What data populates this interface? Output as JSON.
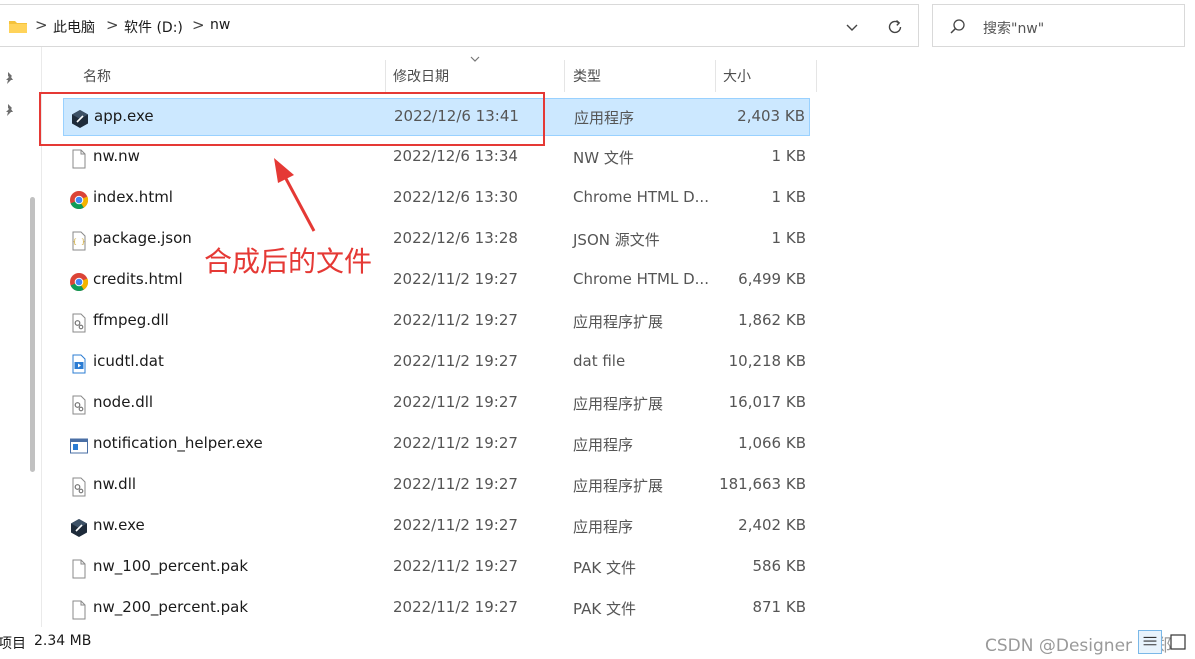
{
  "breadcrumb": {
    "items": [
      "此电脑",
      "软件 (D:)",
      "nw"
    ],
    "separator": ">"
  },
  "search": {
    "placeholder": "搜索\"nw\""
  },
  "columns": {
    "name": "名称",
    "date": "修改日期",
    "type": "类型",
    "size": "大小"
  },
  "files": [
    {
      "name": "app.exe",
      "date": "2022/12/6 13:41",
      "type": "应用程序",
      "size": "2,403 KB",
      "icon": "nw-exe-icon",
      "selected": true
    },
    {
      "name": "nw.nw",
      "date": "2022/12/6 13:34",
      "type": "NW 文件",
      "size": "1 KB",
      "icon": "file-icon"
    },
    {
      "name": "index.html",
      "date": "2022/12/6 13:30",
      "type": "Chrome HTML D...",
      "size": "1 KB",
      "icon": "chrome-icon"
    },
    {
      "name": "package.json",
      "date": "2022/12/6 13:28",
      "type": "JSON 源文件",
      "size": "1 KB",
      "icon": "json-file-icon"
    },
    {
      "name": "credits.html",
      "date": "2022/11/2 19:27",
      "type": "Chrome HTML D...",
      "size": "6,499 KB",
      "icon": "chrome-icon"
    },
    {
      "name": "ffmpeg.dll",
      "date": "2022/11/2 19:27",
      "type": "应用程序扩展",
      "size": "1,862 KB",
      "icon": "dll-icon"
    },
    {
      "name": "icudtl.dat",
      "date": "2022/11/2 19:27",
      "type": "dat file",
      "size": "10,218 KB",
      "icon": "media-file-icon"
    },
    {
      "name": "node.dll",
      "date": "2022/11/2 19:27",
      "type": "应用程序扩展",
      "size": "16,017 KB",
      "icon": "dll-icon"
    },
    {
      "name": "notification_helper.exe",
      "date": "2022/11/2 19:27",
      "type": "应用程序",
      "size": "1,066 KB",
      "icon": "app-window-icon"
    },
    {
      "name": "nw.dll",
      "date": "2022/11/2 19:27",
      "type": "应用程序扩展",
      "size": "181,663 KB",
      "icon": "dll-icon"
    },
    {
      "name": "nw.exe",
      "date": "2022/11/2 19:27",
      "type": "应用程序",
      "size": "2,402 KB",
      "icon": "nw-exe-icon"
    },
    {
      "name": "nw_100_percent.pak",
      "date": "2022/11/2 19:27",
      "type": "PAK 文件",
      "size": "586 KB",
      "icon": "file-icon"
    },
    {
      "name": "nw_200_percent.pak",
      "date": "2022/11/2 19:27",
      "type": "PAK 文件",
      "size": "871 KB",
      "icon": "file-icon"
    }
  ],
  "annotation": {
    "text": "合成后的文件",
    "color": "#e53935"
  },
  "status": {
    "items_text": "项目",
    "selected_size": "2.34 MB",
    "watermark": "CSDN @Designer 小郑"
  },
  "colors": {
    "selection": "#cce8ff",
    "selection_border": "#99d1ff",
    "folder": "#f4c23c"
  }
}
